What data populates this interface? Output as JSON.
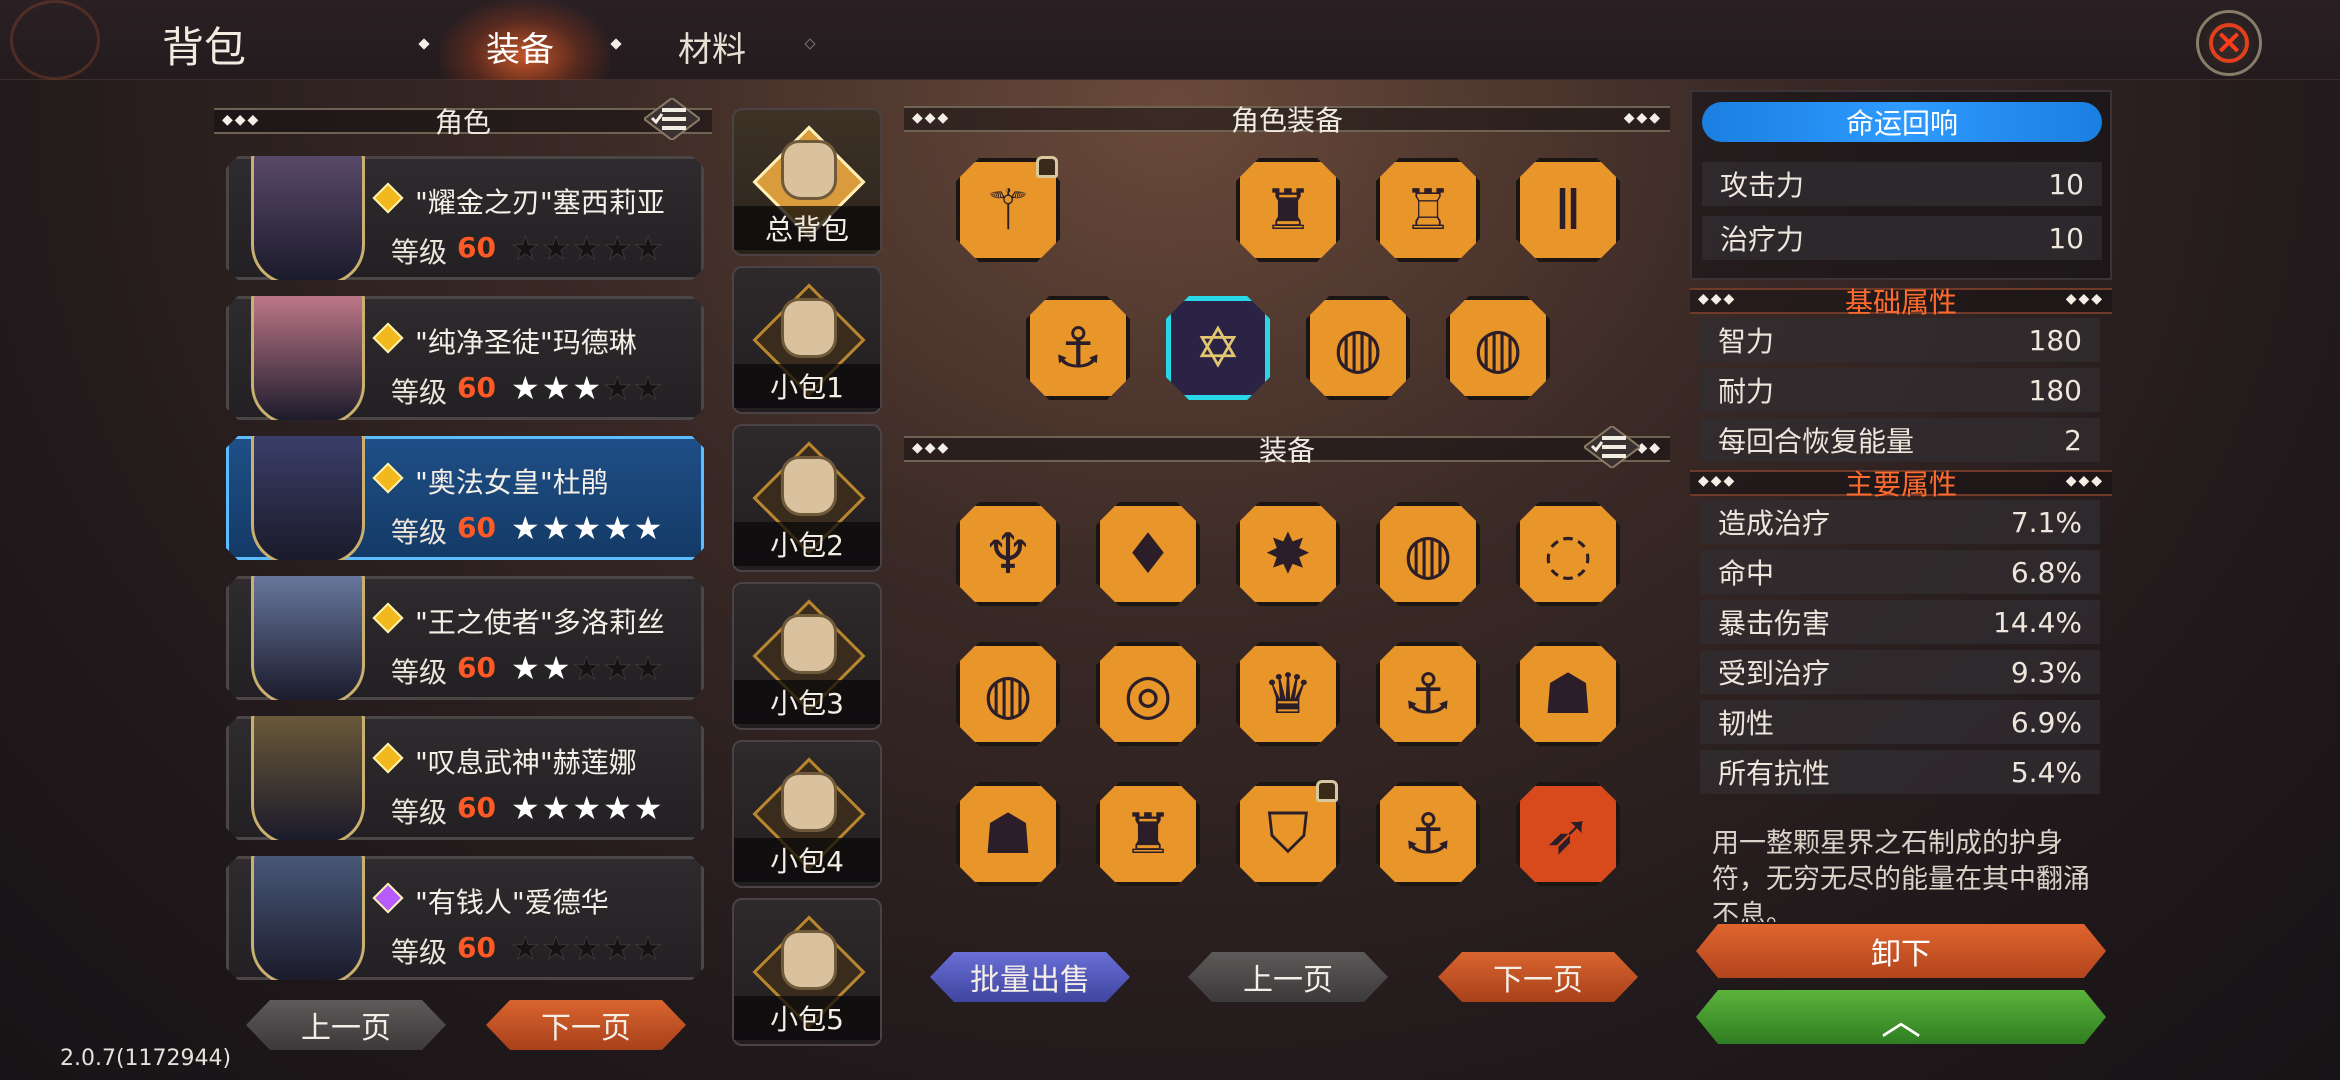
{
  "header": {
    "title": "背包",
    "tabs": [
      {
        "label": "装备",
        "active": true
      },
      {
        "label": "材料",
        "active": false
      }
    ]
  },
  "left": {
    "section_title": "角色",
    "characters": [
      {
        "name": "\"耀金之刃\"塞西莉亚",
        "level_label": "等级",
        "level": "60",
        "stars": 0,
        "gem": "gold",
        "selected": false
      },
      {
        "name": "\"纯净圣徒\"玛德琳",
        "level_label": "等级",
        "level": "60",
        "stars": 3,
        "gem": "gold",
        "selected": false
      },
      {
        "name": "\"奥法女皇\"杜鹃",
        "level_label": "等级",
        "level": "60",
        "stars": 5,
        "gem": "gold",
        "selected": true
      },
      {
        "name": "\"王之使者\"多洛莉丝",
        "level_label": "等级",
        "level": "60",
        "stars": 2,
        "gem": "gold",
        "selected": false
      },
      {
        "name": "\"叹息武神\"赫莲娜",
        "level_label": "等级",
        "level": "60",
        "stars": 5,
        "gem": "gold",
        "selected": false
      },
      {
        "name": "\"有钱人\"爱德华",
        "level_label": "等级",
        "level": "60",
        "stars": 0,
        "gem": "purple",
        "selected": false
      }
    ],
    "prev_label": "上一页",
    "next_label": "下一页"
  },
  "bags": [
    {
      "label": "总背包",
      "active": true
    },
    {
      "label": "小包1",
      "active": false
    },
    {
      "label": "小包2",
      "active": false
    },
    {
      "label": "小包3",
      "active": false
    },
    {
      "label": "小包4",
      "active": false
    },
    {
      "label": "小包5",
      "active": false
    }
  ],
  "middle": {
    "equipped_title": "角色装备",
    "equipped_row1": [
      {
        "icon": "staff-icon",
        "glyph": "⚚",
        "locked": true
      },
      {
        "icon": "empty-slot",
        "glyph": "",
        "empty": true
      },
      {
        "icon": "chest-armor-icon",
        "glyph": "♜"
      },
      {
        "icon": "coat-icon",
        "glyph": "♖"
      },
      {
        "icon": "trousers-icon",
        "glyph": "Ⅱ"
      }
    ],
    "equipped_row2": [
      {
        "icon": "boots-icon",
        "glyph": "⚓"
      },
      {
        "icon": "hexagram-amulet-icon",
        "glyph": "✡",
        "selected": true
      },
      {
        "icon": "ring-icon",
        "glyph": "◍"
      },
      {
        "icon": "ring-icon",
        "glyph": "◍"
      }
    ],
    "inventory_title": "装备",
    "inventory": [
      {
        "icon": "wing-pendant-icon",
        "glyph": "♆"
      },
      {
        "icon": "red-pendant-icon",
        "glyph": "♦"
      },
      {
        "icon": "star-necklace-icon",
        "glyph": "✸"
      },
      {
        "icon": "ring-icon",
        "glyph": "◍"
      },
      {
        "icon": "silver-ring-icon",
        "glyph": "◌"
      },
      {
        "icon": "blue-ring-icon",
        "glyph": "◍"
      },
      {
        "icon": "purple-ring-icon",
        "glyph": "◎"
      },
      {
        "icon": "crown-icon",
        "glyph": "♛"
      },
      {
        "icon": "boots-icon",
        "glyph": "⚓"
      },
      {
        "icon": "hood-icon",
        "glyph": "☗"
      },
      {
        "icon": "hood-icon",
        "glyph": "☗"
      },
      {
        "icon": "robe-icon",
        "glyph": "♜"
      },
      {
        "icon": "gauntlets-icon",
        "glyph": "⛉",
        "locked": true
      },
      {
        "icon": "shoes-icon",
        "glyph": "⚓"
      },
      {
        "icon": "spear-icon",
        "glyph": "➶",
        "red": true
      }
    ],
    "bulk_sell_label": "批量出售",
    "prev_label": "上一页",
    "next_label": "下一页"
  },
  "right": {
    "fate_title": "命运回响",
    "fate_stats": [
      {
        "name": "攻击力",
        "value": "10"
      },
      {
        "name": "治疗力",
        "value": "10"
      }
    ],
    "base_title": "基础属性",
    "base_stats": [
      {
        "name": "智力",
        "value": "180"
      },
      {
        "name": "耐力",
        "value": "180"
      },
      {
        "name": "每回合恢复能量",
        "value": "2"
      }
    ],
    "main_title": "主要属性",
    "main_stats": [
      {
        "name": "造成治疗",
        "value": "7.1%"
      },
      {
        "name": "命中",
        "value": "6.8%"
      },
      {
        "name": "暴击伤害",
        "value": "14.4%"
      },
      {
        "name": "受到治疗",
        "value": "9.3%"
      },
      {
        "name": "韧性",
        "value": "6.9%"
      },
      {
        "name": "所有抗性",
        "value": "5.4%"
      }
    ],
    "description": "用一整颗星界之石制成的护身符，无穷无尽的能量在其中翻涌不息。",
    "unequip_label": "卸下",
    "upgrade_glyph": "︿"
  },
  "version": "2.0.7(1172944)",
  "colors": {
    "accent_orange": "#e8952a",
    "selected_blue": "#1e4f87",
    "fate_blue": "#2f9aff",
    "green": "#5bb43a"
  }
}
